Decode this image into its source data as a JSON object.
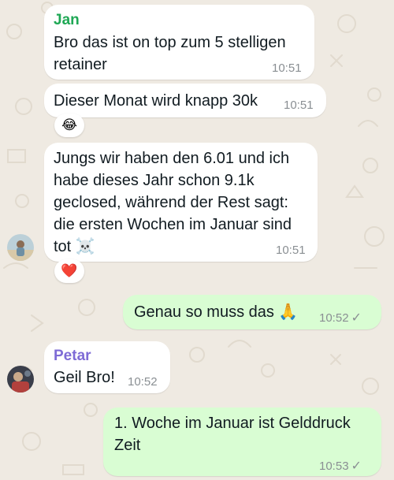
{
  "chat": {
    "messages": [
      {
        "sender": "Jan",
        "text": "Bro das ist on top zum 5 stelligen retainer",
        "time": "10:51"
      },
      {
        "text": "Dieser Monat wird knapp 30k",
        "time": "10:51",
        "reaction": "😂"
      },
      {
        "text": "Jungs wir haben den 6.01 und ich habe dieses Jahr schon 9.1k geclosed, während der Rest sagt: die ersten Wochen im Januar sind tot ☠️",
        "time": "10:51",
        "reaction": "❤️"
      },
      {
        "text": "Genau so muss das 🙏",
        "time": "10:52",
        "outgoing": true,
        "read_status": "✓"
      },
      {
        "sender": "Petar",
        "text": "Geil Bro!",
        "time": "10:52"
      },
      {
        "text": "1. Woche im Januar ist Gelddruck Zeit",
        "time": "10:53",
        "outgoing": true,
        "read_status": "✓"
      }
    ]
  },
  "colors": {
    "wallpaper": "#efeae2",
    "incoming_bubble": "#ffffff",
    "outgoing_bubble": "#d9fdd3",
    "sender_jan": "#1fa855",
    "sender_petar": "#7e6bd6",
    "timestamp": "#8a8f93"
  },
  "icons": {
    "avatar_jan": "avatar-icon",
    "avatar_petar": "avatar-icon",
    "read_check": "check-icon"
  }
}
